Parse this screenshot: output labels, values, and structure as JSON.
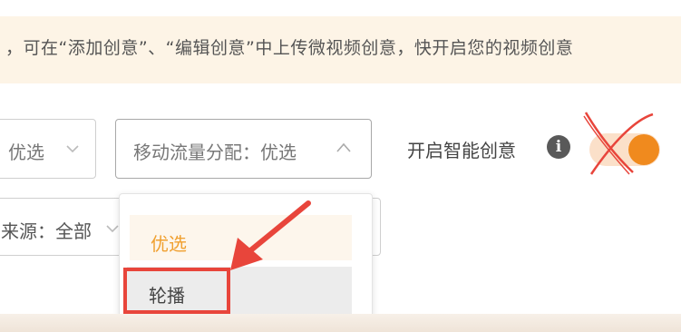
{
  "notice": {
    "text": "，可在“添加创意”、“编辑创意”中上传微视频创意，快开启您的视频创意"
  },
  "filters": {
    "left_select_value": "优选",
    "mobile_flow_select": "移动流量分配：优选",
    "source_select": "来源：全部"
  },
  "smart_creative": {
    "label": "开启智能创意",
    "info_icon": "i",
    "toggle_on": true
  },
  "dropdown": {
    "options": [
      "优选",
      "轮播"
    ],
    "selected_option": "优选",
    "hovered_option": "轮播"
  },
  "colors": {
    "accent_orange": "#f08a1e",
    "annotation_red": "#e8453b",
    "notice_bg": "#fdf4e6"
  },
  "icons": {
    "chevron": "chevron-down-icon",
    "chevron_up": "chevron-up-icon",
    "info": "info-icon"
  }
}
